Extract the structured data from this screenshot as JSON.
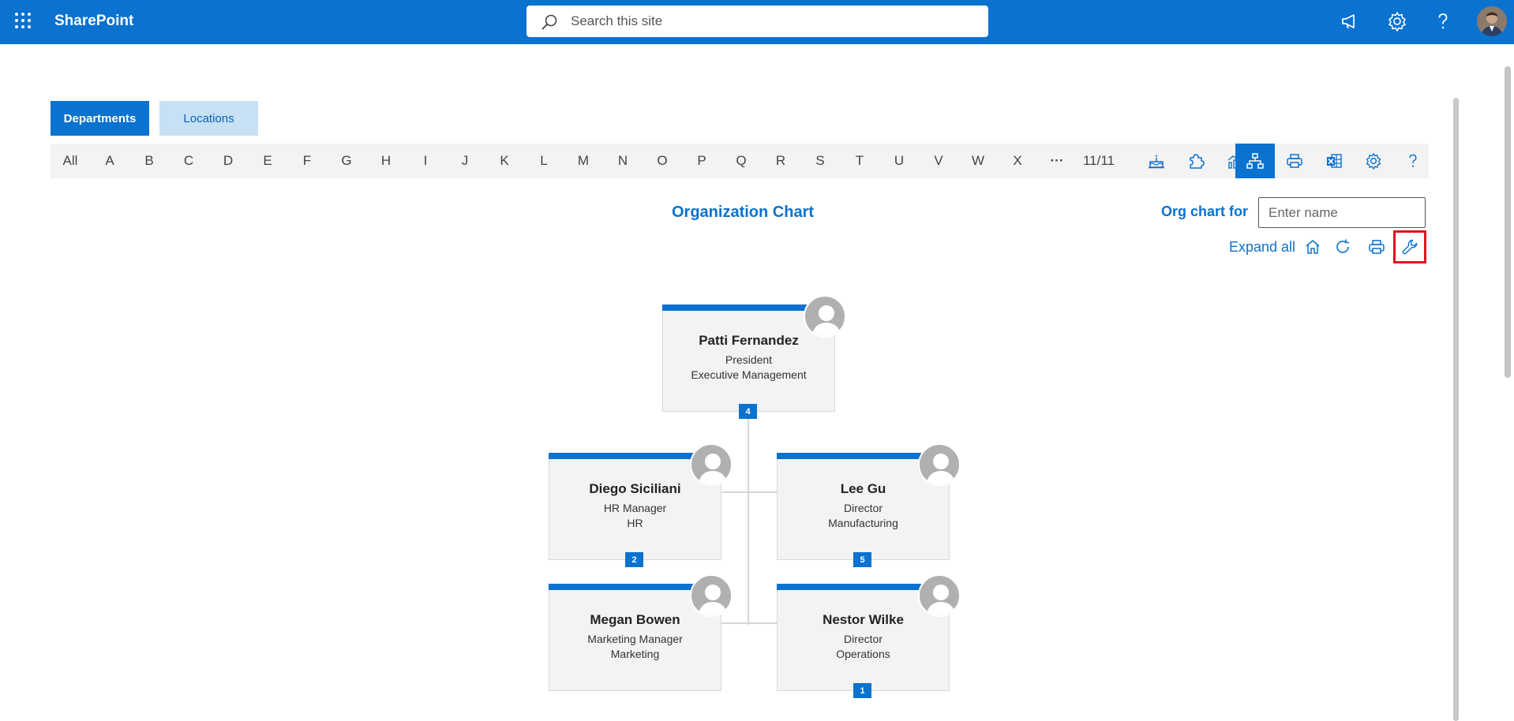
{
  "topbar": {
    "app_name": "SharePoint",
    "search_placeholder": "Search this site",
    "icons": [
      "app-launcher-icon",
      "megaphone-icon",
      "gear-icon",
      "help-icon",
      "user-avatar"
    ]
  },
  "tabs": [
    {
      "label": "Departments",
      "selected": true
    },
    {
      "label": "Locations",
      "selected": false
    }
  ],
  "letters": [
    "All",
    "A",
    "B",
    "C",
    "D",
    "E",
    "F",
    "G",
    "H",
    "I",
    "J",
    "K",
    "L",
    "M",
    "N",
    "O",
    "P",
    "Q",
    "R",
    "S",
    "T",
    "U",
    "V",
    "W",
    "X"
  ],
  "toolbar": {
    "more_label": "···",
    "page_count": "11/11",
    "tools": [
      "birthday-cake-icon",
      "puzzle-icon",
      "chart-icon",
      "org-chart-icon",
      "print-icon",
      "excel-icon",
      "settings-icon",
      "help-icon"
    ],
    "active_tool": "org-chart-icon"
  },
  "orgchart": {
    "title": "Organization Chart",
    "for_label": "Org chart for",
    "name_placeholder": "Enter name",
    "expand_all": "Expand all",
    "tools": [
      "home-icon",
      "refresh-icon",
      "print-icon",
      "wrench-icon"
    ],
    "root": {
      "name": "Patti Fernandez",
      "title": "President",
      "department": "Executive Management",
      "reports": "4"
    },
    "children": [
      {
        "name": "Diego Siciliani",
        "title": "HR Manager",
        "department": "HR",
        "reports": "2"
      },
      {
        "name": "Lee Gu",
        "title": "Director",
        "department": "Manufacturing",
        "reports": "5"
      },
      {
        "name": "Megan Bowen",
        "title": "Marketing Manager",
        "department": "Marketing",
        "reports": ""
      },
      {
        "name": "Nestor Wilke",
        "title": "Director",
        "department": "Operations",
        "reports": "1"
      }
    ]
  },
  "colors": {
    "brand": "#0a72cf",
    "tab_inactive": "#c7e0f4",
    "highlight": "#e0141e",
    "card_bg": "#f3f3f3"
  }
}
